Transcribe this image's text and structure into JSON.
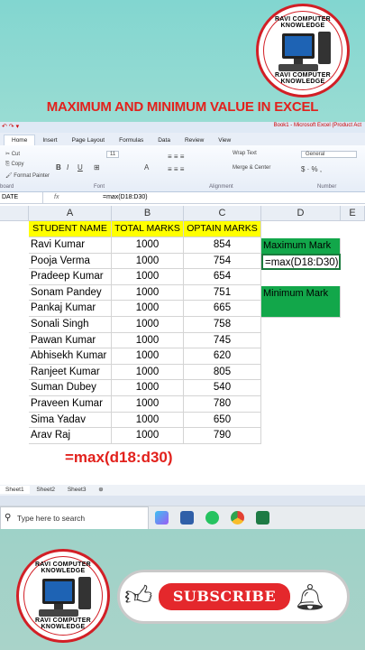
{
  "logo": {
    "text_top": "RAVI COMPUTER KNOWLEDGE",
    "text_bottom": "RAVI COMPUTER KNOWLEDGE"
  },
  "title": "MAXIMUM AND MINIMUM  VALUE IN EXCEL",
  "excel": {
    "window_title": "Book1 - Microsoft Excel (Product Act",
    "tabs": [
      "Home",
      "Insert",
      "Page Layout",
      "Formulas",
      "Data",
      "Review",
      "View"
    ],
    "ribbon": {
      "cut": "Cut",
      "copy": "Copy",
      "format_painter": "Format Painter",
      "clipboard": "board",
      "font_group": "Font",
      "alignment_group": "Alignment",
      "number_group": "Number",
      "wrap_text": "Wrap Text",
      "merge_center": "Merge & Center",
      "general": "General",
      "font_size": "11"
    },
    "name_box": "DATE",
    "fx": "fx",
    "formula": "=max(D18:D30)",
    "columns": [
      "A",
      "B",
      "C",
      "D",
      "E"
    ],
    "headers": [
      "STUDENT NAME",
      "TOTAL MARKS",
      "OPTAIN MARKS"
    ],
    "rows": [
      {
        "name": "Ravi Kumar",
        "total": "1000",
        "obtain": "854"
      },
      {
        "name": "Pooja Verma",
        "total": "1000",
        "obtain": "754"
      },
      {
        "name": "Pradeep Kumar",
        "total": "1000",
        "obtain": "654"
      },
      {
        "name": "Sonam Pandey",
        "total": "1000",
        "obtain": "751"
      },
      {
        "name": "Pankaj Kumar",
        "total": "1000",
        "obtain": "665"
      },
      {
        "name": "Sonali Singh",
        "total": "1000",
        "obtain": "758"
      },
      {
        "name": "Pawan Kumar",
        "total": "1000",
        "obtain": "745"
      },
      {
        "name": "Abhisekh Kumar",
        "total": "1000",
        "obtain": "620"
      },
      {
        "name": "Ranjeet Kumar",
        "total": "1000",
        "obtain": "805"
      },
      {
        "name": "Suman Dubey",
        "total": "1000",
        "obtain": "540"
      },
      {
        "name": "Praveen Kumar",
        "total": "1000",
        "obtain": "780"
      },
      {
        "name": "Sima Yadav",
        "total": "1000",
        "obtain": "650"
      },
      {
        "name": "Arav Raj",
        "total": "1000",
        "obtain": "790"
      }
    ],
    "max_label": "Maximum Mark",
    "max_cell_formula": "=max(D18:D30)",
    "min_label": "Minimum Mark",
    "sheet_tabs": [
      "Sheet1",
      "Sheet2",
      "Sheet3"
    ]
  },
  "overlay_formula": "=max(d18:d30)",
  "taskbar": {
    "search_placeholder": "Type here to search"
  },
  "footer": {
    "subscribe": "SUBSCRIBE"
  },
  "colors": {
    "title_red": "#e2211c",
    "header_yellow": "#ffff00",
    "result_green": "#12a74a",
    "subscribe_red": "#e4282c"
  }
}
